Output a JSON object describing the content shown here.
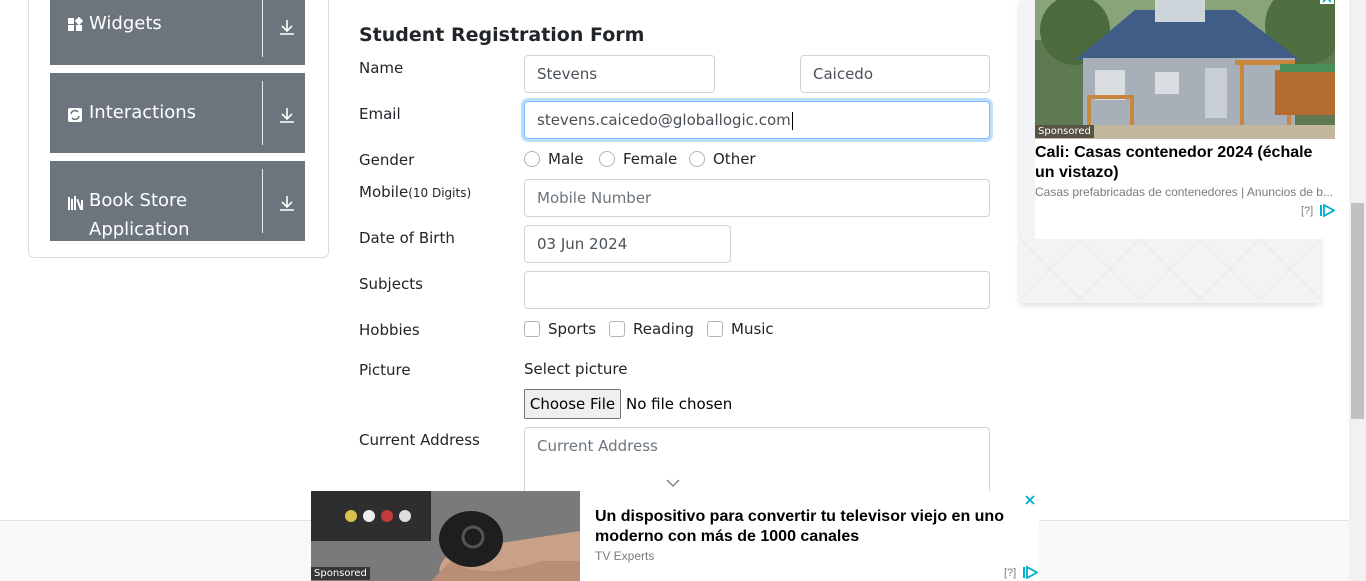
{
  "sidebar": {
    "groups": [
      {
        "label": "Widgets",
        "icon": "widgets-icon"
      },
      {
        "label": "Interactions",
        "icon": "interactions-icon"
      },
      {
        "label": "Book Store",
        "label2": "Application",
        "icon": "book-store-icon"
      }
    ],
    "color": "#6c757d"
  },
  "form": {
    "title": "Student Registration Form",
    "name_label": "Name",
    "first_name": "Stevens",
    "last_name": "Caicedo",
    "email_label": "Email",
    "email": "stevens.caicedo@globallogic.com",
    "gender_label": "Gender",
    "gender_options": [
      "Male",
      "Female",
      "Other"
    ],
    "mobile_label": "Mobile",
    "mobile_hint": "(10 Digits)",
    "mobile_placeholder": "Mobile Number",
    "dob_label": "Date of Birth",
    "dob": "03 Jun 2024",
    "subjects_label": "Subjects",
    "hobbies_label": "Hobbies",
    "hobby_options": [
      "Sports",
      "Reading",
      "Music"
    ],
    "picture_label": "Picture",
    "select_picture": "Select picture",
    "choose_file": "Choose File",
    "no_file": "No file chosen",
    "address_label": "Current Address",
    "address_placeholder": "Current Address"
  },
  "ad_right": {
    "sponsored": "Sponsored",
    "title": "Cali: Casas contenedor 2024 (échale un vistazo)",
    "subtitle": "Casas prefabricadas de contenedores | Anuncios de b...",
    "help": "[?]"
  },
  "ad_bottom": {
    "sponsored": "Sponsored",
    "title": "Un dispositivo para convertir tu televisor viejo en uno moderno con más de 1000 canales",
    "subtitle": "TV Experts",
    "help": "[?]",
    "close": "✕"
  },
  "colors": {
    "focus": "#80bdff",
    "adchoice": "#00aecd"
  }
}
